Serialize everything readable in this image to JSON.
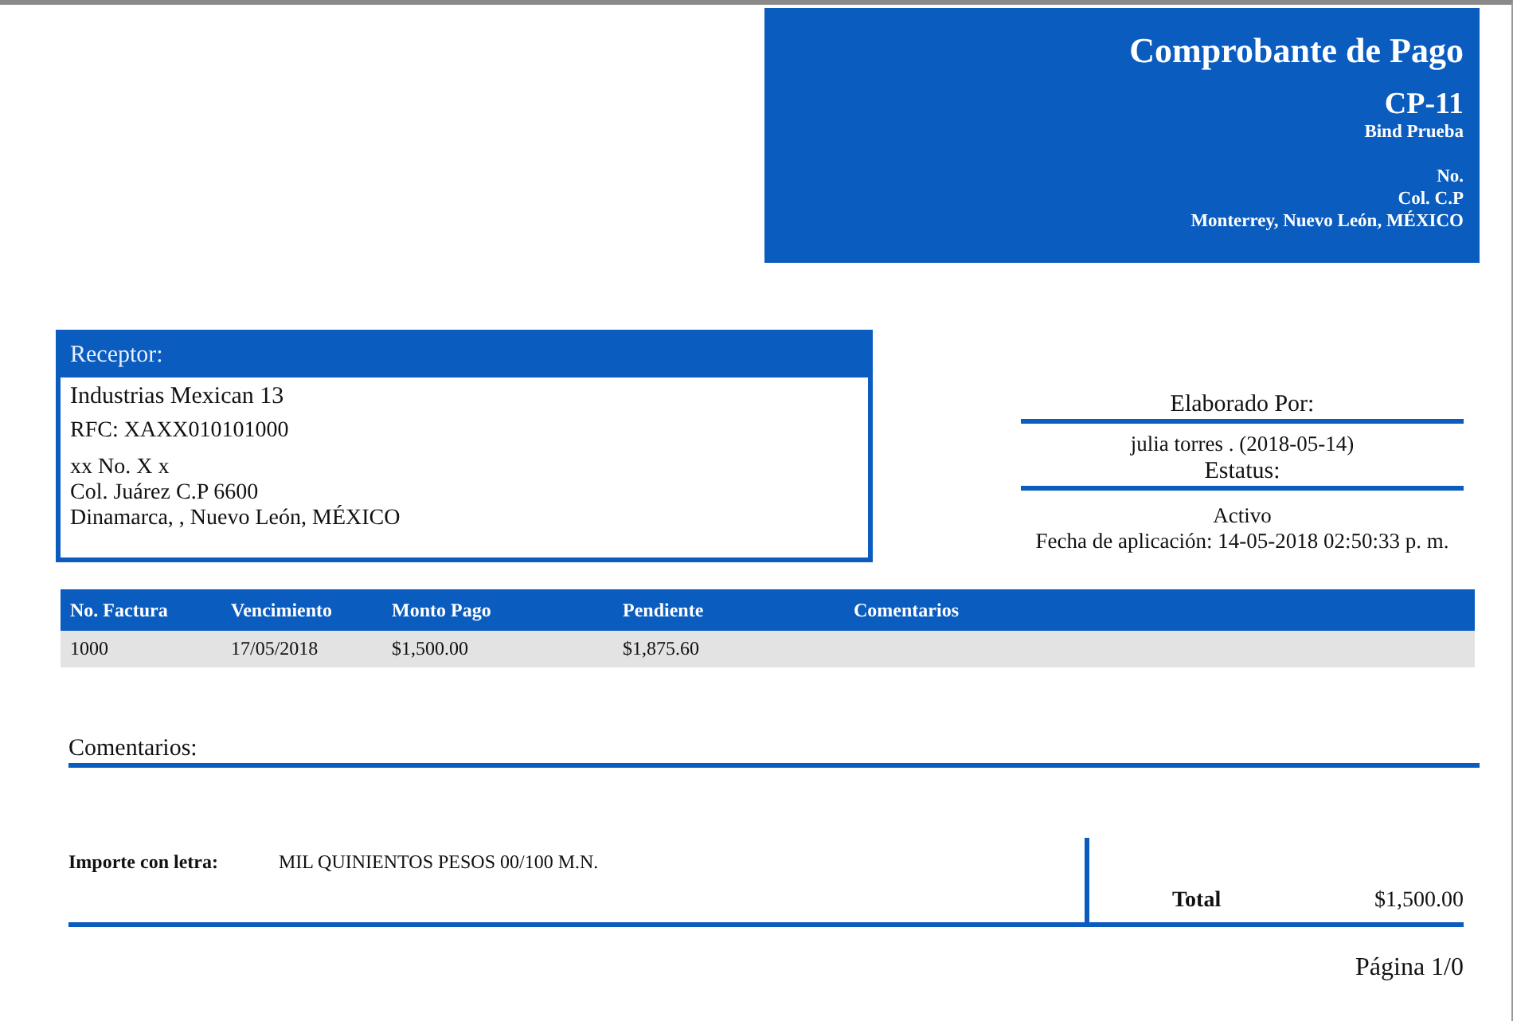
{
  "header": {
    "title": "Comprobante de Pago",
    "folio": "CP-11",
    "company": "Bind Prueba",
    "address_lines": [
      "No.",
      "Col. C.P",
      "Monterrey, Nuevo León, MÉXICO"
    ]
  },
  "receptor": {
    "heading": "Receptor:",
    "name": "Industrias Mexican 13",
    "rfc": "RFC: XAXX010101000",
    "address_lines": [
      "xx No. X x",
      "Col. Juárez C.P 6600",
      "Dinamarca, , Nuevo León, MÉXICO"
    ]
  },
  "info": {
    "elaborado_label": "Elaborado Por:",
    "elaborado_value": "julia torres . (2018-05-14)",
    "estatus_label": "Estatus:",
    "estatus_value": "Activo",
    "fecha": "Fecha de aplicación: 14-05-2018 02:50:33 p. m."
  },
  "table": {
    "columns": [
      "No. Factura",
      "Vencimiento",
      "Monto Pago",
      "Pendiente",
      "Comentarios"
    ],
    "rows": [
      [
        "1000",
        "17/05/2018",
        "$1,500.00",
        "$1,875.60",
        ""
      ]
    ]
  },
  "comentarios_label": "Comentarios:",
  "importe": {
    "label": "Importe con letra:",
    "value": "MIL QUINIENTOS PESOS 00/100 M.N."
  },
  "total": {
    "label": "Total",
    "value": "$1,500.00"
  },
  "footer": {
    "page": "Página 1/0"
  }
}
